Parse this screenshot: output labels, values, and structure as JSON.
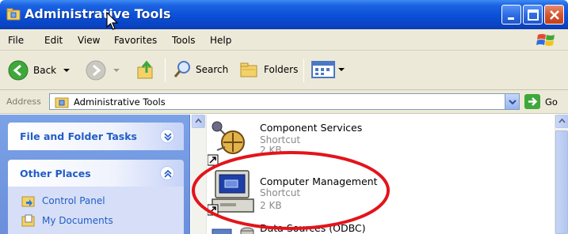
{
  "window": {
    "title": "Administrative Tools",
    "title_icon": "control-panel-folder-icon"
  },
  "menu": {
    "items": [
      "File",
      "Edit",
      "View",
      "Favorites",
      "Tools",
      "Help"
    ]
  },
  "toolbar": {
    "back_label": "Back",
    "search_label": "Search",
    "folders_label": "Folders"
  },
  "address": {
    "label": "Address",
    "value": "Administrative Tools",
    "go_label": "Go"
  },
  "left_pane": {
    "sections": [
      {
        "title": "File and Folder Tasks"
      },
      {
        "title": "Other Places",
        "links": [
          "Control Panel",
          "My Documents"
        ]
      }
    ]
  },
  "items": [
    {
      "name": "Component Services",
      "type": "Shortcut",
      "size": "2 KB"
    },
    {
      "name": "Computer Management",
      "type": "Shortcut",
      "size": "2 KB"
    },
    {
      "name": "Data Sources (ODBC)"
    }
  ],
  "colors": {
    "titlebar": "#0a4fd6",
    "chrome": "#ece9d8",
    "task_pane": "#6b8fdb",
    "task_link": "#215dc6",
    "highlight": "#e3141b"
  }
}
